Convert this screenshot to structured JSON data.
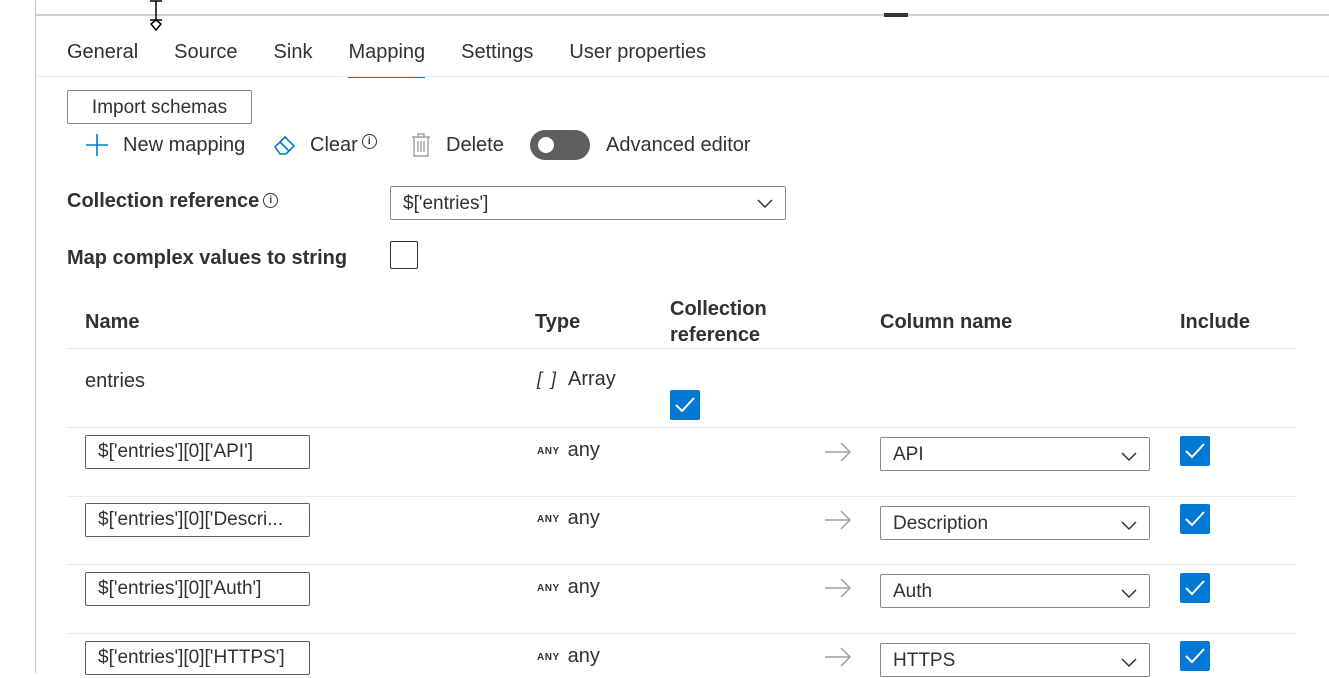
{
  "tabs": [
    "General",
    "Source",
    "Sink",
    "Mapping",
    "Settings",
    "User properties"
  ],
  "active_tab": "Mapping",
  "toolbar": {
    "import_schemas": "Import schemas",
    "new_mapping": "New mapping",
    "clear": "Clear",
    "delete": "Delete",
    "advanced_editor": "Advanced editor",
    "info_glyph": "i"
  },
  "collection_reference": {
    "label": "Collection reference",
    "value": "$['entries']"
  },
  "map_complex": {
    "label": "Map complex values to string",
    "checked": false
  },
  "table": {
    "headers": {
      "name": "Name",
      "type": "Type",
      "collection_ref_line1": "Collection",
      "collection_ref_line2": "reference",
      "column_name": "Column name",
      "include": "Include"
    },
    "array_row": {
      "name": "entries",
      "type_tag": "[ ]",
      "type": "Array",
      "collection_checked": true
    },
    "any_tag": "ANY",
    "rows": [
      {
        "path": "$['entries'][0]['API']",
        "type": "any",
        "column": "API",
        "include": true
      },
      {
        "path": "$['entries'][0]['Descri...",
        "type": "any",
        "column": "Description",
        "include": true
      },
      {
        "path": "$['entries'][0]['Auth']",
        "type": "any",
        "column": "Auth",
        "include": true
      },
      {
        "path": "$['entries'][0]['HTTPS']",
        "type": "any",
        "column": "HTTPS",
        "include": true
      }
    ]
  },
  "colors": {
    "accent": "#0078d4",
    "toggle_off": "#605e5c",
    "text": "#323130"
  },
  "icons": [
    "plus-icon",
    "eraser-icon",
    "info-icon",
    "trash-icon",
    "chevron-down-icon",
    "arrow-right-icon",
    "checkmark-icon",
    "text-cursor-icon"
  ]
}
